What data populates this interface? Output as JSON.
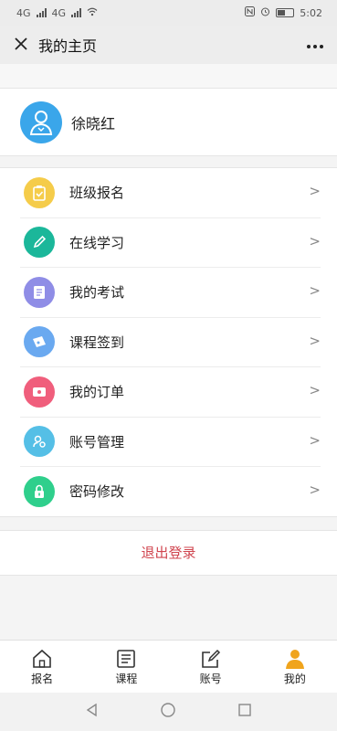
{
  "status_bar": {
    "time": "5:02",
    "network_a": "4G",
    "network_b": "4G"
  },
  "nav": {
    "title": "我的主页",
    "close_icon": "close-icon",
    "more_icon": "more-icon"
  },
  "profile": {
    "name": "徐晓红",
    "avatar_color": "#3aa6ea"
  },
  "menu": {
    "items": [
      {
        "label": "班级报名",
        "icon": "clipboard-icon",
        "color": "#f5cc4a",
        "arrow": ">"
      },
      {
        "label": "在线学习",
        "icon": "pencil-icon",
        "color": "#1bb79a",
        "arrow": ">"
      },
      {
        "label": "我的考试",
        "icon": "document-icon",
        "color": "#8f8de6",
        "arrow": ">"
      },
      {
        "label": "课程签到",
        "icon": "ticket-icon",
        "color": "#6aa9f0",
        "arrow": ">"
      },
      {
        "label": "我的订单",
        "icon": "wallet-icon",
        "color": "#f05e7c",
        "arrow": ">"
      },
      {
        "label": "账号管理",
        "icon": "account-icon",
        "color": "#55bfe6",
        "arrow": ">"
      },
      {
        "label": "密码修改",
        "icon": "lock-icon",
        "color": "#2fcf8c",
        "arrow": ">"
      }
    ]
  },
  "logout": {
    "label": "退出登录",
    "color": "#d0454f"
  },
  "tabs": [
    {
      "label": "报名",
      "icon": "home-icon",
      "active": false
    },
    {
      "label": "课程",
      "icon": "book-icon",
      "active": false
    },
    {
      "label": "账号",
      "icon": "edit-icon",
      "active": false
    },
    {
      "label": "我的",
      "icon": "user-icon",
      "active": true,
      "color": "#f0a41c"
    }
  ]
}
